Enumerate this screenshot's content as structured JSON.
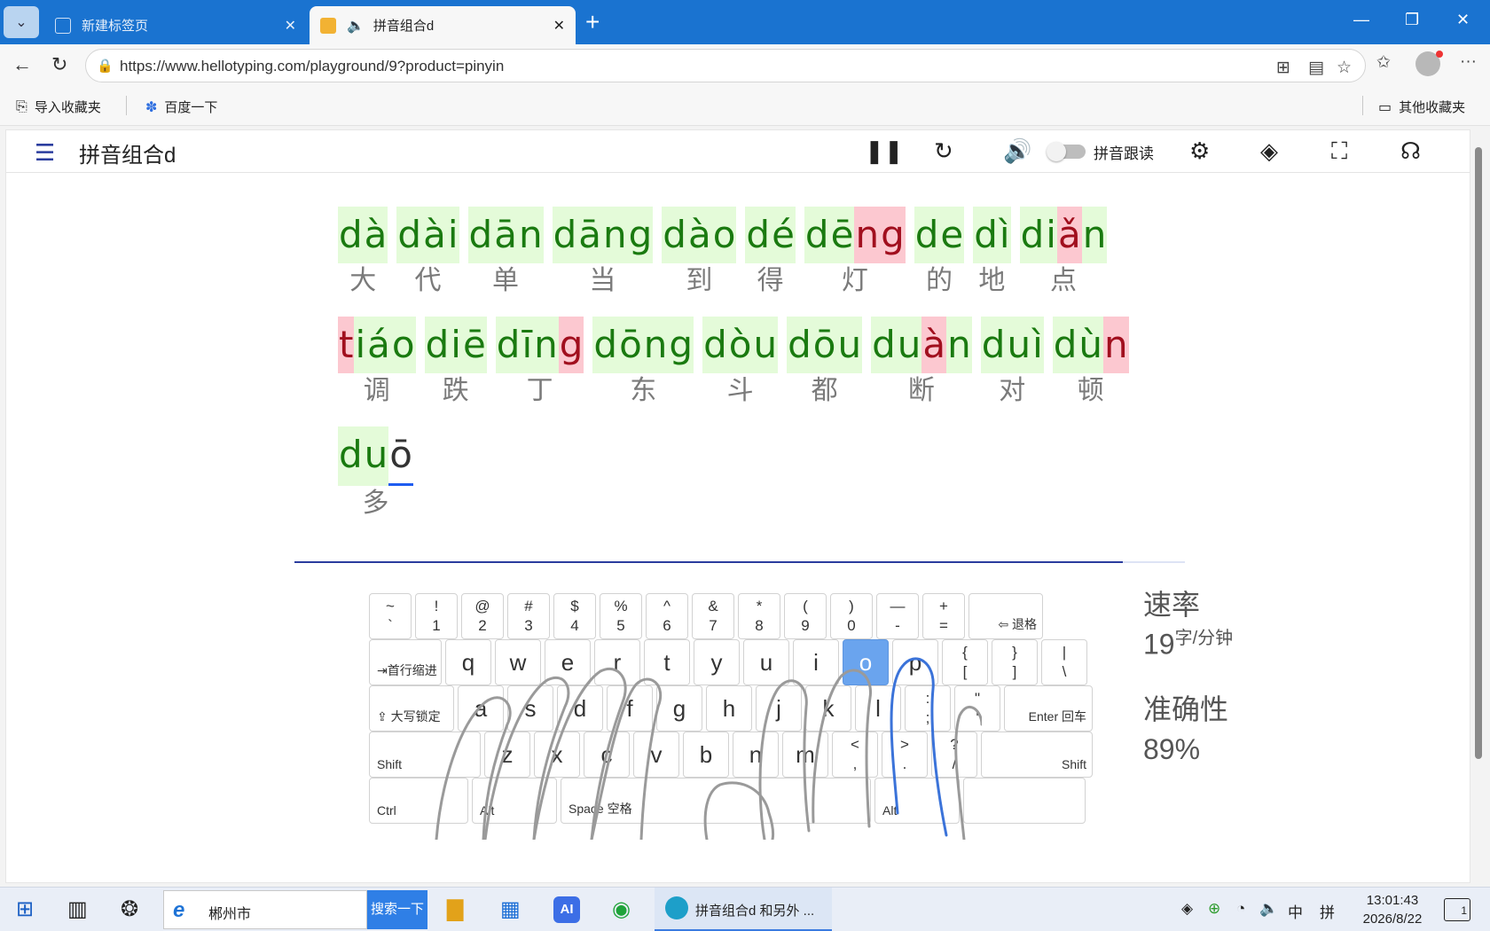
{
  "browser": {
    "tabs": [
      {
        "title": "新建标签页",
        "active": false
      },
      {
        "title": "拼音组合d",
        "active": true
      }
    ],
    "url": "https://www.hellotyping.com/playground/9?product=pinyin",
    "bookmarks": {
      "import": "导入收藏夹",
      "baidu": "百度一下",
      "other": "其他收藏夹"
    }
  },
  "app": {
    "title": "拼音组合d",
    "toggle_label": "拼音跟读",
    "toggle_on": false
  },
  "typing": {
    "rows": [
      [
        {
          "chars": [
            {
              "c": "d",
              "s": "ok"
            },
            {
              "c": "à",
              "s": "ok"
            }
          ],
          "hanzi": "大"
        },
        {
          "chars": [
            {
              "c": "d",
              "s": "ok"
            },
            {
              "c": "à",
              "s": "ok"
            },
            {
              "c": "i",
              "s": "ok"
            }
          ],
          "hanzi": "代"
        },
        {
          "chars": [
            {
              "c": "d",
              "s": "ok"
            },
            {
              "c": "ā",
              "s": "ok"
            },
            {
              "c": "n",
              "s": "ok"
            }
          ],
          "hanzi": "单"
        },
        {
          "chars": [
            {
              "c": "d",
              "s": "ok"
            },
            {
              "c": "ā",
              "s": "ok"
            },
            {
              "c": "n",
              "s": "ok"
            },
            {
              "c": "g",
              "s": "ok"
            }
          ],
          "hanzi": "当"
        },
        {
          "chars": [
            {
              "c": "d",
              "s": "ok"
            },
            {
              "c": "à",
              "s": "ok"
            },
            {
              "c": "o",
              "s": "ok"
            }
          ],
          "hanzi": "到"
        },
        {
          "chars": [
            {
              "c": "d",
              "s": "ok"
            },
            {
              "c": "é",
              "s": "ok"
            }
          ],
          "hanzi": "得"
        },
        {
          "chars": [
            {
              "c": "d",
              "s": "ok"
            },
            {
              "c": "ē",
              "s": "ok"
            },
            {
              "c": "n",
              "s": "err"
            },
            {
              "c": "g",
              "s": "err"
            }
          ],
          "hanzi": "灯"
        },
        {
          "chars": [
            {
              "c": "d",
              "s": "ok"
            },
            {
              "c": "e",
              "s": "ok"
            }
          ],
          "hanzi": "的"
        },
        {
          "chars": [
            {
              "c": "d",
              "s": "ok"
            },
            {
              "c": "ì",
              "s": "ok"
            }
          ],
          "hanzi": "地"
        },
        {
          "chars": [
            {
              "c": "d",
              "s": "ok"
            },
            {
              "c": "i",
              "s": "ok"
            },
            {
              "c": "ǎ",
              "s": "err"
            },
            {
              "c": "n",
              "s": "ok"
            }
          ],
          "hanzi": "点"
        }
      ],
      [
        {
          "chars": [
            {
              "c": "t",
              "s": "err"
            },
            {
              "c": "i",
              "s": "ok"
            },
            {
              "c": "á",
              "s": "ok"
            },
            {
              "c": "o",
              "s": "ok"
            }
          ],
          "hanzi": "调"
        },
        {
          "chars": [
            {
              "c": "d",
              "s": "ok"
            },
            {
              "c": "i",
              "s": "ok"
            },
            {
              "c": "ē",
              "s": "ok"
            }
          ],
          "hanzi": "跌"
        },
        {
          "chars": [
            {
              "c": "d",
              "s": "ok"
            },
            {
              "c": "ī",
              "s": "ok"
            },
            {
              "c": "n",
              "s": "ok"
            },
            {
              "c": "g",
              "s": "err"
            }
          ],
          "hanzi": "丁"
        },
        {
          "chars": [
            {
              "c": "d",
              "s": "ok"
            },
            {
              "c": "ō",
              "s": "ok"
            },
            {
              "c": "n",
              "s": "ok"
            },
            {
              "c": "g",
              "s": "ok"
            }
          ],
          "hanzi": "东"
        },
        {
          "chars": [
            {
              "c": "d",
              "s": "ok"
            },
            {
              "c": "ò",
              "s": "ok"
            },
            {
              "c": "u",
              "s": "ok"
            }
          ],
          "hanzi": "斗"
        },
        {
          "chars": [
            {
              "c": "d",
              "s": "ok"
            },
            {
              "c": "ō",
              "s": "ok"
            },
            {
              "c": "u",
              "s": "ok"
            }
          ],
          "hanzi": "都"
        },
        {
          "chars": [
            {
              "c": "d",
              "s": "ok"
            },
            {
              "c": "u",
              "s": "ok"
            },
            {
              "c": "à",
              "s": "err"
            },
            {
              "c": "n",
              "s": "ok"
            }
          ],
          "hanzi": "断"
        },
        {
          "chars": [
            {
              "c": "d",
              "s": "ok"
            },
            {
              "c": "u",
              "s": "ok"
            },
            {
              "c": "ì",
              "s": "ok"
            }
          ],
          "hanzi": "对"
        },
        {
          "chars": [
            {
              "c": "d",
              "s": "ok"
            },
            {
              "c": "ù",
              "s": "ok"
            },
            {
              "c": "n",
              "s": "err"
            }
          ],
          "hanzi": "顿"
        }
      ],
      [
        {
          "chars": [
            {
              "c": "d",
              "s": "ok"
            },
            {
              "c": "u",
              "s": "ok"
            },
            {
              "c": "ō",
              "s": "cursor"
            }
          ],
          "hanzi": "多"
        }
      ]
    ],
    "progress": 0.93
  },
  "keyboard": {
    "active_key": "o",
    "rows": [
      [
        {
          "top": "~",
          "bot": "`",
          "w": 48
        },
        {
          "top": "!",
          "bot": "1",
          "w": 48
        },
        {
          "top": "@",
          "bot": "2",
          "w": 48
        },
        {
          "top": "#",
          "bot": "3",
          "w": 48
        },
        {
          "top": "$",
          "bot": "4",
          "w": 48
        },
        {
          "top": "%",
          "bot": "5",
          "w": 48
        },
        {
          "top": "^",
          "bot": "6",
          "w": 48
        },
        {
          "top": "&",
          "bot": "7",
          "w": 48
        },
        {
          "top": "*",
          "bot": "8",
          "w": 48
        },
        {
          "top": "(",
          "bot": "9",
          "w": 48
        },
        {
          "top": ")",
          "bot": "0",
          "w": 48
        },
        {
          "top": "—",
          "bot": "-",
          "w": 48
        },
        {
          "top": "+",
          "bot": "=",
          "w": 48
        },
        {
          "label": "⇦ 退格",
          "w": 84,
          "align": "right"
        }
      ],
      [
        {
          "label": "⇥首行缩进",
          "w": 82
        },
        {
          "main": "q",
          "w": 52
        },
        {
          "main": "w",
          "w": 52
        },
        {
          "main": "e",
          "w": 52
        },
        {
          "main": "r",
          "w": 52
        },
        {
          "main": "t",
          "w": 52
        },
        {
          "main": "y",
          "w": 52
        },
        {
          "main": "u",
          "w": 52
        },
        {
          "main": "i",
          "w": 52
        },
        {
          "main": "o",
          "w": 52
        },
        {
          "main": "p",
          "w": 52
        },
        {
          "top": "{",
          "bot": "[",
          "w": 52
        },
        {
          "top": "}",
          "bot": "]",
          "w": 52
        },
        {
          "top": "|",
          "bot": "\\",
          "w": 52
        }
      ],
      [
        {
          "label": "⇪ 大写锁定",
          "w": 96
        },
        {
          "main": "a",
          "w": 52
        },
        {
          "main": "s",
          "w": 52
        },
        {
          "main": "d",
          "w": 52
        },
        {
          "main": "f",
          "w": 52
        },
        {
          "main": "g",
          "w": 52
        },
        {
          "main": "h",
          "w": 52
        },
        {
          "main": "j",
          "w": 52
        },
        {
          "main": "k",
          "w": 52
        },
        {
          "main": "l",
          "w": 52
        },
        {
          "top": ":",
          "bot": ";",
          "w": 52
        },
        {
          "top": "\"",
          "bot": "'",
          "w": 52
        },
        {
          "label": "Enter 回车",
          "w": 100,
          "align": "right"
        }
      ],
      [
        {
          "label": "Shift",
          "w": 126
        },
        {
          "main": "z",
          "w": 52
        },
        {
          "main": "x",
          "w": 52
        },
        {
          "main": "c",
          "w": 52
        },
        {
          "main": "v",
          "w": 52
        },
        {
          "main": "b",
          "w": 52
        },
        {
          "main": "n",
          "w": 52
        },
        {
          "main": "m",
          "w": 52
        },
        {
          "top": "<",
          "bot": ",",
          "w": 52
        },
        {
          "top": ">",
          "bot": ".",
          "w": 52
        },
        {
          "top": "?",
          "bot": "/",
          "w": 52
        },
        {
          "label": "Shift",
          "w": 126,
          "align": "right"
        }
      ],
      [
        {
          "label": "Ctrl",
          "w": 112
        },
        {
          "label": "Alt",
          "w": 96
        },
        {
          "label": "Space 空格",
          "w": 350
        },
        {
          "label": "Alt",
          "w": 96
        },
        {
          "label": "",
          "w": 138
        }
      ]
    ]
  },
  "stats": {
    "speed_label": "速率",
    "speed_value": "19",
    "speed_unit": "字/分钟",
    "accuracy_label": "准确性",
    "accuracy_value": "89%"
  },
  "taskbar": {
    "search_text": "郴州市",
    "search_button": "搜索一下",
    "active_window": "拼音组合d 和另外 ...",
    "ime": "中",
    "ime2": "拼",
    "time": "13:01:43",
    "date": "2026/8/22",
    "notifications": "1"
  }
}
